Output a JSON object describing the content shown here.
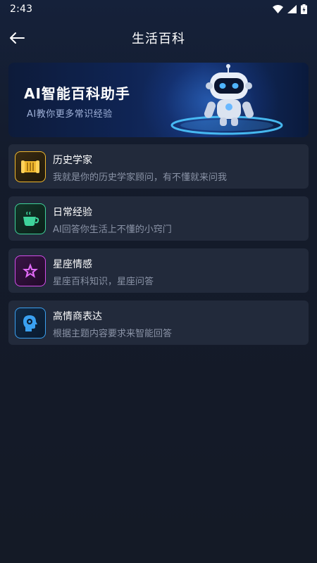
{
  "status": {
    "time": "2:43",
    "icons": [
      "wifi-icon",
      "signal-icon",
      "battery-icon"
    ]
  },
  "header": {
    "title": "生活百科",
    "back_icon": "arrow-left-icon"
  },
  "banner": {
    "title": "AI智能百科助手",
    "subtitle": "AI教你更多常识经验",
    "image": "robot-illustration"
  },
  "items": [
    {
      "title": "历史学家",
      "desc": "我就是你的历史学家顾问，有不懂就来问我",
      "icon": "scroll-icon",
      "color": "#f0b82e"
    },
    {
      "title": "日常经验",
      "desc": "AI回答你生活上不懂的小窍门",
      "icon": "coffee-cup-icon",
      "color": "#3ed39a"
    },
    {
      "title": "星座情感",
      "desc": "星座百科知识，星座问答",
      "icon": "star-icon",
      "color": "#d24ce8"
    },
    {
      "title": "高情商表达",
      "desc": "根据主题内容要求来智能回答",
      "icon": "head-gear-icon",
      "color": "#3aa0f0"
    }
  ],
  "colors": {
    "background": "#141a26",
    "card": "#222a3b",
    "text_primary": "#ffffff",
    "text_secondary": "#8a93a6"
  }
}
